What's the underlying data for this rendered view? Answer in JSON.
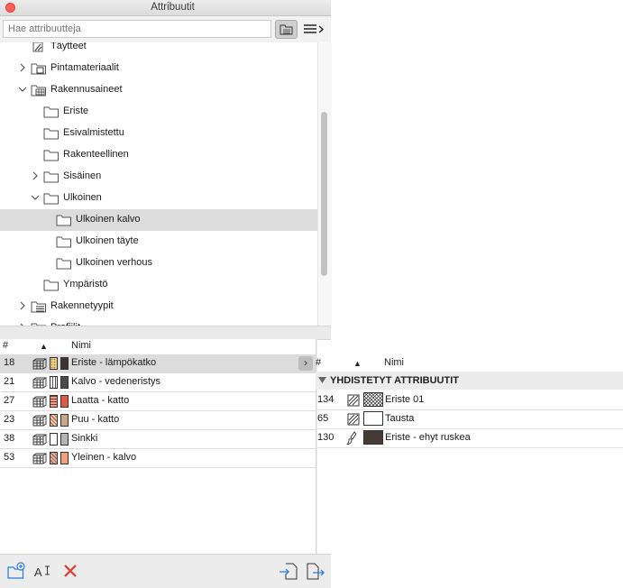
{
  "window": {
    "title": "Attribuutit"
  },
  "search": {
    "placeholder": "Hae attribuutteja"
  },
  "tree": [
    {
      "label": "Täytteet",
      "indent": 0,
      "chevron": "none",
      "icon": "fill-icon"
    },
    {
      "label": "Pintamateriaalit",
      "indent": 0,
      "chevron": "right",
      "icon": "surface-icon"
    },
    {
      "label": "Rakennusaineet",
      "indent": 0,
      "chevron": "down",
      "icon": "building-material-icon"
    },
    {
      "label": "Eriste",
      "indent": 1,
      "chevron": "none",
      "icon": "folder-icon"
    },
    {
      "label": "Esivalmistettu",
      "indent": 1,
      "chevron": "none",
      "icon": "folder-icon"
    },
    {
      "label": "Rakenteellinen",
      "indent": 1,
      "chevron": "none",
      "icon": "folder-icon"
    },
    {
      "label": "Sisäinen",
      "indent": 1,
      "chevron": "right",
      "icon": "folder-icon"
    },
    {
      "label": "Ulkoinen",
      "indent": 1,
      "chevron": "down",
      "icon": "folder-icon"
    },
    {
      "label": "Ulkoinen kalvo",
      "indent": 2,
      "chevron": "none",
      "icon": "folder-icon",
      "selected": true
    },
    {
      "label": "Ulkoinen täyte",
      "indent": 2,
      "chevron": "none",
      "icon": "folder-icon"
    },
    {
      "label": "Ulkoinen verhous",
      "indent": 2,
      "chevron": "none",
      "icon": "folder-icon"
    },
    {
      "label": "Ympäristö",
      "indent": 1,
      "chevron": "none",
      "icon": "folder-icon"
    },
    {
      "label": "Rakennetyypit",
      "indent": 0,
      "chevron": "right",
      "icon": "composite-icon"
    },
    {
      "label": "Profiilit",
      "indent": 0,
      "chevron": "right",
      "icon": "profile-icon"
    }
  ],
  "list": {
    "col_num": "#",
    "col_sort": "▲",
    "col_name": "Nimi",
    "rows": [
      {
        "num": "18",
        "name": "Eriste - lämpökatko",
        "swatch_a": "#f3d38a",
        "swatch_a_pattern": "dots",
        "swatch_b": "#3d3431",
        "selected": true
      },
      {
        "num": "21",
        "name": "Kalvo - vedeneristys",
        "swatch_a": "#ffffff",
        "swatch_a_pattern": "lines",
        "swatch_b": "#4a4a4a"
      },
      {
        "num": "27",
        "name": "Laatta - katto",
        "swatch_a": "#e8a08a",
        "swatch_a_pattern": "hlines",
        "swatch_b": "#e05a45"
      },
      {
        "num": "23",
        "name": "Puu - katto",
        "swatch_a": "#f0c7a8",
        "swatch_a_pattern": "diag",
        "swatch_b": "#c9a58a"
      },
      {
        "num": "38",
        "name": "Sinkki",
        "swatch_a": "#ffffff",
        "swatch_a_pattern": "none",
        "swatch_b": "#b4b4b4"
      },
      {
        "num": "53",
        "name": "Yleinen - kalvo",
        "swatch_a": "#e0b0a0",
        "swatch_a_pattern": "diag",
        "swatch_b": "#f2a07a"
      }
    ]
  },
  "details": {
    "col_num": "#",
    "col_sort": "▲",
    "col_name": "Nimi",
    "group_label": "YHDISTETYT ATTRIBUUTIT",
    "rows": [
      {
        "num": "134",
        "name": "Eriste 01",
        "icon": "fill-icon",
        "swatch": "#ffffff",
        "pattern": "crosshatch"
      },
      {
        "num": "65",
        "name": "Tausta",
        "icon": "fill-icon",
        "swatch": "#ffffff",
        "pattern": "none"
      },
      {
        "num": "130",
        "name": "Eriste - ehyt ruskea",
        "icon": "paint-brush-icon",
        "swatch": "#453a36",
        "pattern": "none"
      }
    ]
  },
  "toolbar": {
    "buttons": [
      "new-folder-icon",
      "rename-icon",
      "delete-icon",
      "import-icon",
      "export-icon"
    ]
  },
  "colors": {
    "selection": "#dcdcdc",
    "delete": "#e23b2e",
    "accent": "#2a7bd6"
  }
}
